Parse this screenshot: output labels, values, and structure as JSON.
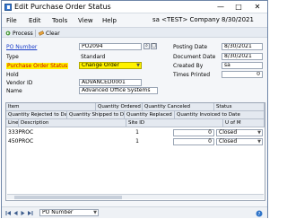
{
  "window": {
    "title": "Edit Purchase Order Status",
    "close_glyph": "✕"
  },
  "menu": {
    "items": [
      "File",
      "Edit",
      "Tools",
      "View",
      "Help"
    ],
    "company": "sa  <TEST> Company  8/30/2021"
  },
  "toolbar": {
    "process": "Process",
    "clear": "Clear"
  },
  "header": {
    "po_number_label": "PO Number",
    "po_number_value": "PO2094",
    "type_label": "Type",
    "type_value": "Standard",
    "status_label": "Purchase Order Status",
    "status_value": "Change Order",
    "hold_label": "Hold",
    "vendor_id_label": "Vendor ID",
    "vendor_id_value": "ADVANCED0001",
    "name_label": "Name",
    "name_value": "Advanced Office Systems",
    "posting_date_label": "Posting Date",
    "posting_date_value": "8/30/2021",
    "document_date_label": "Document Date",
    "document_date_value": "8/30/2021",
    "created_by_label": "Created By",
    "created_by_value": "sa",
    "times_printed_label": "Times Printed",
    "times_printed_value": "0"
  },
  "grid": {
    "header_row1": [
      "Item",
      "Quantity Ordered",
      "Quantity Canceled",
      "Status"
    ],
    "header_row2": [
      "Quantity Rejected to Date",
      "Quantity Shipped to Date",
      "Quantity Replaced",
      "Quantity Invoiced to Date"
    ],
    "header_row3": [
      "Line",
      "Description",
      "Site ID",
      "U of M"
    ],
    "rows": [
      {
        "item": "333PROC",
        "qty_ordered": "1",
        "qty_canceled": "0",
        "status": "Closed"
      },
      {
        "item": "450PROC",
        "qty_ordered": "1",
        "qty_canceled": "0",
        "status": "Closed"
      }
    ]
  },
  "statusbar": {
    "sort_value": "PO Number"
  },
  "colors": {
    "highlight": "#fff200",
    "link": "#1a3ec9",
    "status_label": "#cc0000"
  }
}
